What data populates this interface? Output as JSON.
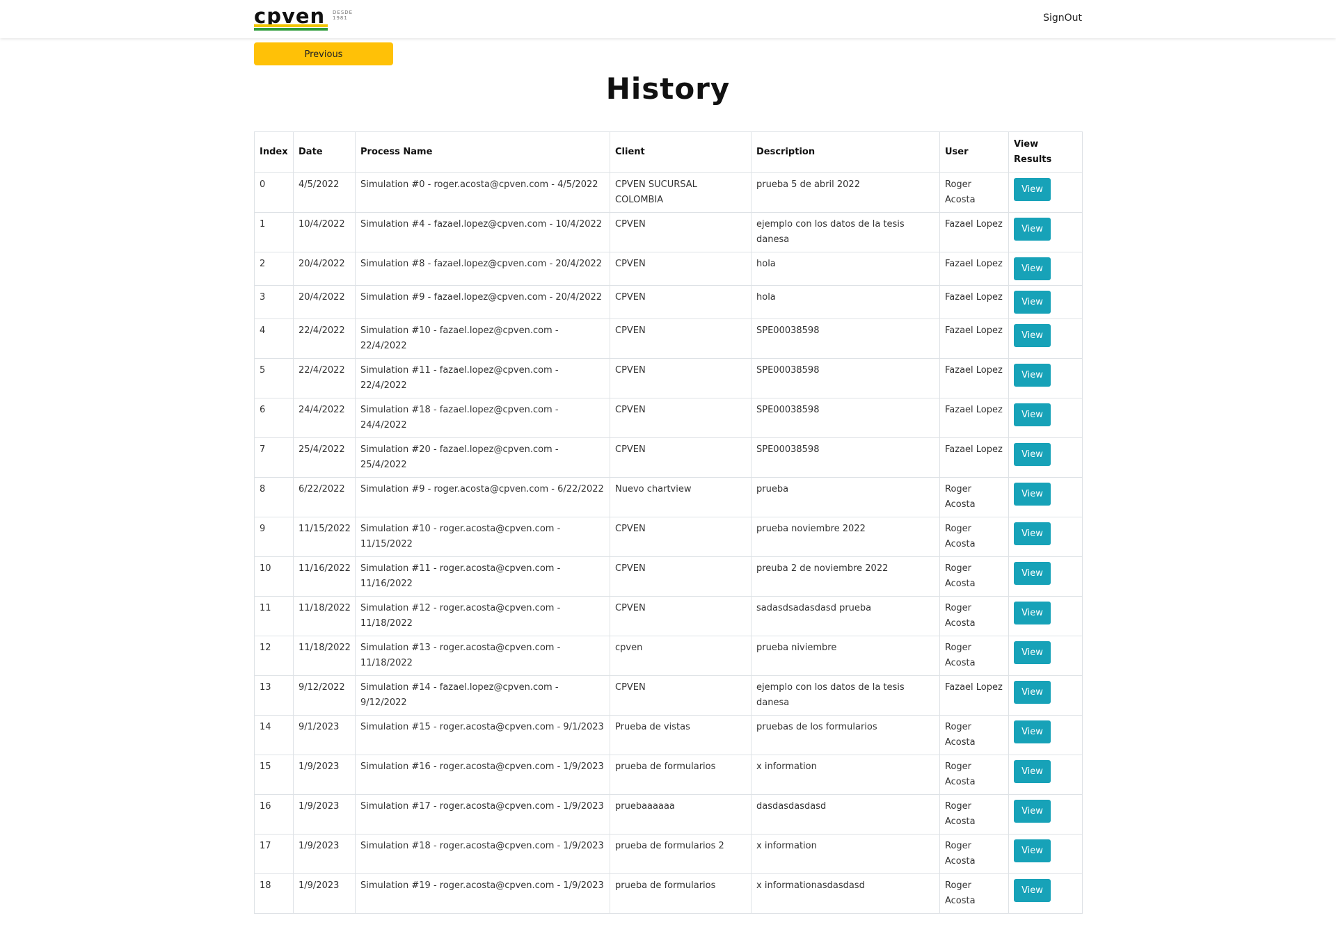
{
  "colors": {
    "accent_yellow": "#ffc107",
    "view_button": "#17a2b8",
    "logo_yellow": "#f2c500",
    "logo_green": "#2e9b3a"
  },
  "header": {
    "logo_text": "cpven",
    "logo_since": "DESDE 1981",
    "signout_label": "SignOut"
  },
  "nav": {
    "previous_label": "Previous"
  },
  "page": {
    "title": "History"
  },
  "table": {
    "headers": {
      "index": "Index",
      "date": "Date",
      "process": "Process Name",
      "client": "Client",
      "description": "Description",
      "user": "User",
      "view": "View Results"
    },
    "view_label": "View",
    "rows": [
      {
        "index": "0",
        "date": "4/5/2022",
        "process": "Simulation #0 - roger.acosta@cpven.com - 4/5/2022",
        "client": "CPVEN SUCURSAL COLOMBIA",
        "description": "prueba 5 de abril 2022",
        "user": "Roger Acosta"
      },
      {
        "index": "1",
        "date": "10/4/2022",
        "process": "Simulation #4 - fazael.lopez@cpven.com - 10/4/2022",
        "client": "CPVEN",
        "description": "ejemplo con los datos de la tesis danesa",
        "user": "Fazael Lopez"
      },
      {
        "index": "2",
        "date": "20/4/2022",
        "process": "Simulation #8 - fazael.lopez@cpven.com - 20/4/2022",
        "client": "CPVEN",
        "description": "hola",
        "user": "Fazael Lopez"
      },
      {
        "index": "3",
        "date": "20/4/2022",
        "process": "Simulation #9 - fazael.lopez@cpven.com - 20/4/2022",
        "client": "CPVEN",
        "description": "hola",
        "user": "Fazael Lopez"
      },
      {
        "index": "4",
        "date": "22/4/2022",
        "process": "Simulation #10 - fazael.lopez@cpven.com - 22/4/2022",
        "client": "CPVEN",
        "description": "SPE00038598",
        "user": "Fazael Lopez"
      },
      {
        "index": "5",
        "date": "22/4/2022",
        "process": "Simulation #11 - fazael.lopez@cpven.com - 22/4/2022",
        "client": "CPVEN",
        "description": "SPE00038598",
        "user": "Fazael Lopez"
      },
      {
        "index": "6",
        "date": "24/4/2022",
        "process": "Simulation #18 - fazael.lopez@cpven.com - 24/4/2022",
        "client": "CPVEN",
        "description": "SPE00038598",
        "user": "Fazael Lopez"
      },
      {
        "index": "7",
        "date": "25/4/2022",
        "process": "Simulation #20 - fazael.lopez@cpven.com - 25/4/2022",
        "client": "CPVEN",
        "description": "SPE00038598",
        "user": "Fazael Lopez"
      },
      {
        "index": "8",
        "date": "6/22/2022",
        "process": "Simulation #9 - roger.acosta@cpven.com - 6/22/2022",
        "client": "Nuevo chartview",
        "description": "prueba",
        "user": "Roger Acosta"
      },
      {
        "index": "9",
        "date": "11/15/2022",
        "process": "Simulation #10 - roger.acosta@cpven.com - 11/15/2022",
        "client": "CPVEN",
        "description": "prueba noviembre 2022",
        "user": "Roger Acosta"
      },
      {
        "index": "10",
        "date": "11/16/2022",
        "process": "Simulation #11 - roger.acosta@cpven.com - 11/16/2022",
        "client": "CPVEN",
        "description": "preuba 2 de noviembre 2022",
        "user": "Roger Acosta"
      },
      {
        "index": "11",
        "date": "11/18/2022",
        "process": "Simulation #12 - roger.acosta@cpven.com - 11/18/2022",
        "client": "CPVEN",
        "description": "sadasdsadasdasd prueba",
        "user": "Roger Acosta"
      },
      {
        "index": "12",
        "date": "11/18/2022",
        "process": "Simulation #13 - roger.acosta@cpven.com - 11/18/2022",
        "client": "cpven",
        "description": "prueba niviembre",
        "user": "Roger Acosta"
      },
      {
        "index": "13",
        "date": "9/12/2022",
        "process": "Simulation #14 - fazael.lopez@cpven.com - 9/12/2022",
        "client": "CPVEN",
        "description": "ejemplo con los datos de la tesis danesa",
        "user": "Fazael Lopez"
      },
      {
        "index": "14",
        "date": "9/1/2023",
        "process": "Simulation #15 - roger.acosta@cpven.com - 9/1/2023",
        "client": "Prueba de vistas",
        "description": "pruebas de los formularios",
        "user": "Roger Acosta"
      },
      {
        "index": "15",
        "date": "1/9/2023",
        "process": "Simulation #16 - roger.acosta@cpven.com - 1/9/2023",
        "client": "prueba de formularios",
        "description": "x information",
        "user": "Roger Acosta"
      },
      {
        "index": "16",
        "date": "1/9/2023",
        "process": "Simulation #17 - roger.acosta@cpven.com - 1/9/2023",
        "client": "pruebaaaaaa",
        "description": "dasdasdasdasd",
        "user": "Roger Acosta"
      },
      {
        "index": "17",
        "date": "1/9/2023",
        "process": "Simulation #18 - roger.acosta@cpven.com - 1/9/2023",
        "client": "prueba de formularios 2",
        "description": "x information",
        "user": "Roger Acosta"
      },
      {
        "index": "18",
        "date": "1/9/2023",
        "process": "Simulation #19 - roger.acosta@cpven.com - 1/9/2023",
        "client": "prueba de formularios",
        "description": "x informationasdasdasd",
        "user": "Roger Acosta"
      }
    ]
  }
}
